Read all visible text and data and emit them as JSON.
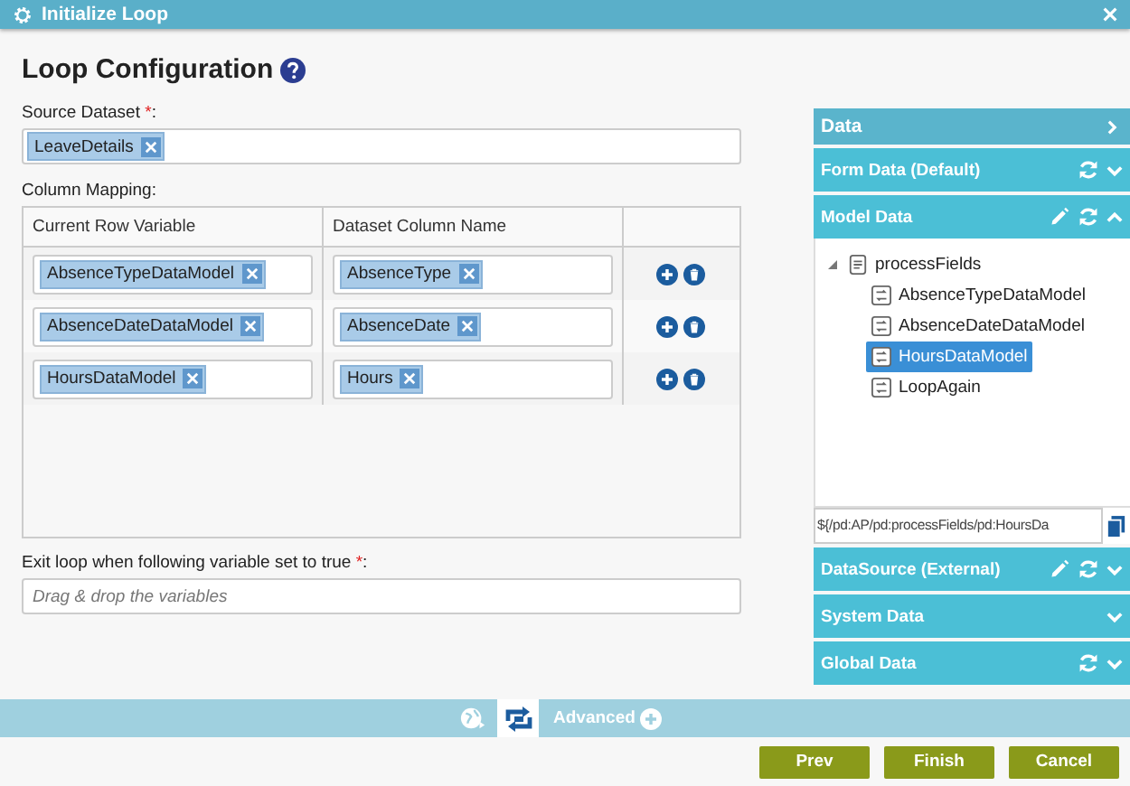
{
  "window": {
    "title": "Initialize Loop"
  },
  "heading": "Loop Configuration",
  "source_dataset": {
    "label": "Source Dataset ",
    "required_mark": "*",
    "suffix": ":",
    "tokens": [
      "LeaveDetails"
    ]
  },
  "column_mapping": {
    "label": "Column Mapping:",
    "columns": [
      "Current Row Variable",
      "Dataset Column Name"
    ],
    "rows": [
      {
        "variable": "AbsenceTypeDataModel",
        "column": "AbsenceType"
      },
      {
        "variable": "AbsenceDateDataModel",
        "column": "AbsenceDate"
      },
      {
        "variable": "HoursDataModel",
        "column": "Hours"
      }
    ]
  },
  "exit_condition": {
    "label": "Exit loop when following variable set to true ",
    "required_mark": "*",
    "suffix": ":",
    "placeholder": "Drag & drop the variables"
  },
  "data_panel": {
    "title": "Data",
    "sections": [
      {
        "title": "Form Data (Default)",
        "editable": false,
        "refreshable": true,
        "expanded": false
      },
      {
        "title": "Model Data",
        "editable": true,
        "refreshable": true,
        "expanded": true,
        "tree": [
          {
            "label": "processFields",
            "expanded": true,
            "children": [
              {
                "label": "AbsenceTypeDataModel",
                "selected": false
              },
              {
                "label": "AbsenceDateDataModel",
                "selected": false
              },
              {
                "label": "HoursDataModel",
                "selected": true
              },
              {
                "label": "LoopAgain",
                "selected": false
              }
            ]
          }
        ],
        "path": "${/pd:AP/pd:processFields/pd:HoursDa"
      },
      {
        "title": "DataSource (External)",
        "editable": true,
        "refreshable": true,
        "expanded": false
      },
      {
        "title": "System Data",
        "editable": false,
        "refreshable": false,
        "expanded": false
      },
      {
        "title": "Global Data",
        "editable": false,
        "refreshable": true,
        "expanded": false
      }
    ]
  },
  "bottom_bar": {
    "advanced_label": "Advanced"
  },
  "buttons": [
    "Prev",
    "Finish",
    "Cancel"
  ]
}
